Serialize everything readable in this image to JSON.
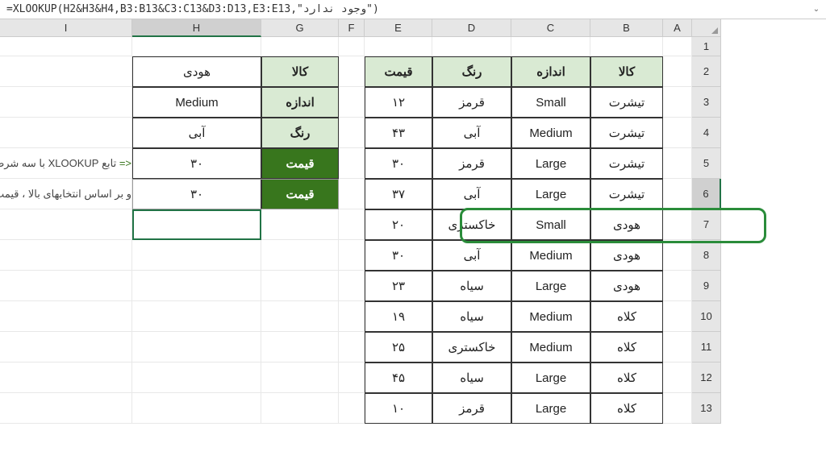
{
  "formula_bar": {
    "formula": "=XLOOKUP(H2&H3&H4,B3:B13&C3:C13&D3:D13,E3:E13,\"وجود ندارد\")"
  },
  "columns": {
    "I": "I",
    "H": "H",
    "G": "G",
    "F": "F",
    "E": "E",
    "D": "D",
    "C": "C",
    "B": "B",
    "A": "A"
  },
  "row_numbers": [
    "1",
    "2",
    "3",
    "4",
    "5",
    "6",
    "7",
    "8",
    "9",
    "10",
    "11",
    "12",
    "13"
  ],
  "main_headers": {
    "kala": "کالا",
    "andaze": "اندازه",
    "rang": "رنگ",
    "qeymat": "قیمت"
  },
  "side_headers": {
    "kala": "کالا",
    "andaze": "اندازه",
    "rang": "رنگ",
    "qeymat": "قیمت",
    "qeymat2": "قیمت"
  },
  "side_values": {
    "kala_val": "هودی",
    "andaze_val": "Medium",
    "rang_val": "آبی",
    "qeymat_val": "۳۰",
    "qeymat2_val": "۳۰"
  },
  "comments": {
    "line1_marker": "<=",
    "line1": " تابع XLOOKUP با سه شرط استفاده شود",
    "line2": "و بر اساس انتخابهای بالا ، قیمت نمایش داده شود ."
  },
  "data_rows": [
    {
      "kala": "تیشرت",
      "andaze": "Small",
      "rang": "قرمز",
      "qeymat": "۱۲"
    },
    {
      "kala": "تیشرت",
      "andaze": "Medium",
      "rang": "آبی",
      "qeymat": "۴۳"
    },
    {
      "kala": "تیشرت",
      "andaze": "Large",
      "rang": "قرمز",
      "qeymat": "۳۰"
    },
    {
      "kala": "تیشرت",
      "andaze": "Large",
      "rang": "آبی",
      "qeymat": "۳۷"
    },
    {
      "kala": "هودی",
      "andaze": "Small",
      "rang": "خاکستری",
      "qeymat": "۲۰"
    },
    {
      "kala": "هودی",
      "andaze": "Medium",
      "rang": "آبی",
      "qeymat": "۳۰"
    },
    {
      "kala": "هودی",
      "andaze": "Large",
      "rang": "سیاه",
      "qeymat": "۲۳"
    },
    {
      "kala": "کلاه",
      "andaze": "Medium",
      "rang": "سیاه",
      "qeymat": "۱۹"
    },
    {
      "kala": "کلاه",
      "andaze": "Medium",
      "rang": "خاکستری",
      "qeymat": "۲۵"
    },
    {
      "kala": "کلاه",
      "andaze": "Large",
      "rang": "سیاه",
      "qeymat": "۴۵"
    },
    {
      "kala": "کلاه",
      "andaze": "Large",
      "rang": "قرمز",
      "qeymat": "۱۰"
    }
  ]
}
